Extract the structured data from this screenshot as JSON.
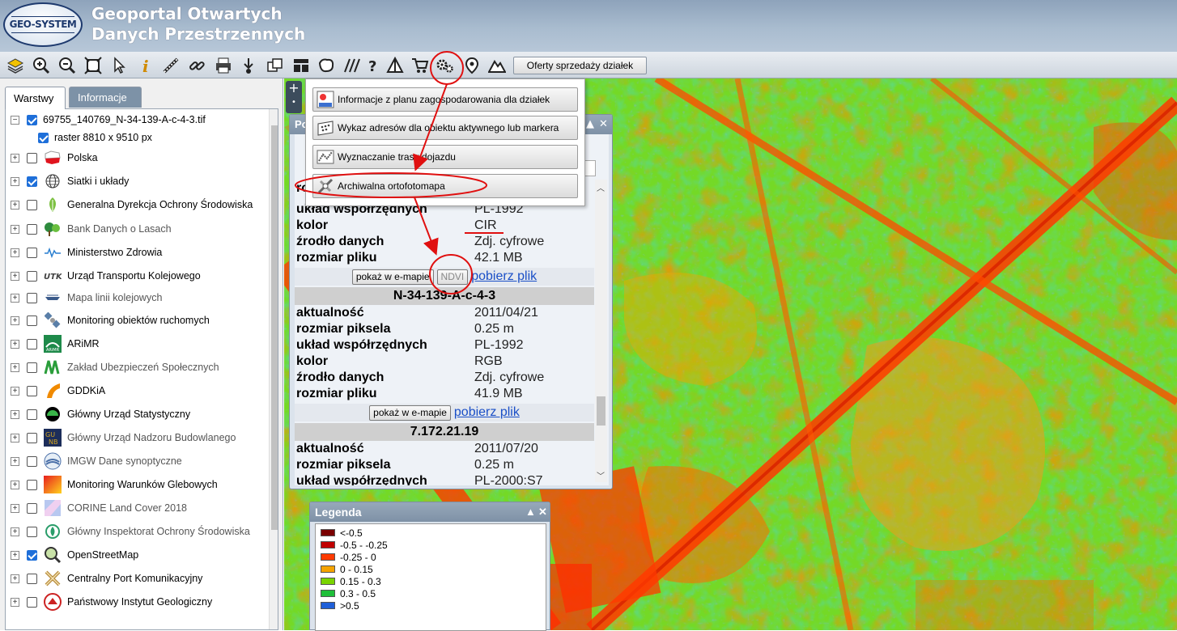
{
  "app": {
    "logo_text": "GEO-SYSTEM",
    "title_line1": "Geoportal Otwartych",
    "title_line2": "Danych Przestrzennych"
  },
  "toolbar": {
    "icons": [
      "layers-icon",
      "zoom-in-icon",
      "zoom-out-icon",
      "zoom-extent-icon",
      "pointer-icon",
      "info-icon",
      "measure-distance-icon",
      "measure-link-icon",
      "print-icon",
      "download-icon",
      "copy-icon",
      "layout-icon",
      "area-icon",
      "hatch-icon",
      "help-icon",
      "triangle-icon",
      "cart-icon",
      "tools-gears-icon",
      "location-pin-icon",
      "terrain-icon"
    ],
    "offers_button": "Oferty sprzedaży działek"
  },
  "left_panel": {
    "tabs": [
      {
        "label": "Warstwy",
        "active": true
      },
      {
        "label": "Informacje",
        "active": false
      }
    ],
    "layers": [
      {
        "label": "69755_140769_N-34-139-A-c-4-3.tif",
        "checked": true,
        "expander": "minus",
        "icon": "none",
        "indent": 0,
        "dim": false
      },
      {
        "label": "raster 8810 x 9510 px",
        "checked": true,
        "expander": "none",
        "icon": "none",
        "indent": 1,
        "dim": false
      },
      {
        "label": "Polska",
        "checked": false,
        "expander": "plus",
        "icon": "poland-flag-icon",
        "indent": 0,
        "dim": false
      },
      {
        "label": "Siatki i układy",
        "checked": true,
        "expander": "plus",
        "icon": "globe-grid-icon",
        "indent": 0,
        "dim": false
      },
      {
        "label": "Generalna Dyrekcja Ochrony Środowiska",
        "checked": false,
        "expander": "plus",
        "icon": "leaf-icon",
        "indent": 0,
        "dim": false
      },
      {
        "label": "Bank Danych o Lasach",
        "checked": false,
        "expander": "plus",
        "icon": "forest-icon",
        "indent": 0,
        "dim": true
      },
      {
        "label": "Ministerstwo Zdrowia",
        "checked": false,
        "expander": "plus",
        "icon": "pulse-icon",
        "indent": 0,
        "dim": false
      },
      {
        "label": "Urząd Transportu Kolejowego",
        "checked": false,
        "expander": "plus",
        "icon": "utk-logo-icon",
        "indent": 0,
        "dim": false
      },
      {
        "label": "Mapa linii kolejowych",
        "checked": false,
        "expander": "plus",
        "icon": "railway-icon",
        "indent": 0,
        "dim": true
      },
      {
        "label": "Monitoring obiektów ruchomych",
        "checked": false,
        "expander": "plus",
        "icon": "satellite-icon",
        "indent": 0,
        "dim": false
      },
      {
        "label": "ARiMR",
        "checked": false,
        "expander": "plus",
        "icon": "arimr-logo-icon",
        "indent": 0,
        "dim": false
      },
      {
        "label": "Zakład Ubezpieczeń Społecznych",
        "checked": false,
        "expander": "plus",
        "icon": "zus-logo-icon",
        "indent": 0,
        "dim": true
      },
      {
        "label": "GDDKiA",
        "checked": false,
        "expander": "plus",
        "icon": "road-icon",
        "indent": 0,
        "dim": false
      },
      {
        "label": "Główny Urząd Statystyczny",
        "checked": false,
        "expander": "plus",
        "icon": "gus-logo-icon",
        "indent": 0,
        "dim": false
      },
      {
        "label": "Główny Urząd Nadzoru Budowlanego",
        "checked": false,
        "expander": "plus",
        "icon": "gunb-logo-icon",
        "indent": 0,
        "dim": true
      },
      {
        "label": "IMGW Dane synoptyczne",
        "checked": false,
        "expander": "plus",
        "icon": "imgw-logo-icon",
        "indent": 0,
        "dim": true
      },
      {
        "label": "Monitoring Warunków Glebowych",
        "checked": false,
        "expander": "plus",
        "icon": "soil-gradient-icon",
        "indent": 0,
        "dim": false
      },
      {
        "label": "CORINE Land Cover 2018",
        "checked": false,
        "expander": "plus",
        "icon": "corine-icon",
        "indent": 0,
        "dim": true
      },
      {
        "label": "Główny Inspektorat Ochrony Środowiska",
        "checked": false,
        "expander": "plus",
        "icon": "gios-logo-icon",
        "indent": 0,
        "dim": true
      },
      {
        "label": "OpenStreetMap",
        "checked": true,
        "expander": "plus",
        "icon": "magnifier-map-icon",
        "indent": 0,
        "dim": false
      },
      {
        "label": "Centralny Port Komunikacyjny",
        "checked": false,
        "expander": "plus",
        "icon": "cpk-logo-icon",
        "indent": 0,
        "dim": false
      },
      {
        "label": "Państwowy Instytut Geologiczny",
        "checked": false,
        "expander": "plus",
        "icon": "pig-logo-icon",
        "indent": 0,
        "dim": false
      }
    ]
  },
  "menu": {
    "items": [
      {
        "label": "Informacje z planu zagospodarowania dla działek",
        "icon": "mpzp-icon"
      },
      {
        "label": "Wykaz adresów dla obiektu aktywnego lub markera",
        "icon": "address-list-icon"
      },
      {
        "label": "Wyznaczanie trasy dojazdu",
        "icon": "route-icon"
      },
      {
        "label": "Archiwalna ortofotomapa",
        "icon": "archive-ortho-icon"
      }
    ]
  },
  "popup": {
    "title_fragment": "Po",
    "partial_top_label": "ro",
    "block1": {
      "rows": [
        {
          "k": "układ współrzędnych",
          "v": "PL-1992"
        },
        {
          "k": "kolor",
          "v": "CIR"
        },
        {
          "k": "źrodło danych",
          "v": "Zdj. cyfrowe"
        },
        {
          "k": "rozmiar pliku",
          "v": "42.1 MB"
        }
      ],
      "show_btn": "pokaż w e-mapie",
      "ndvi_btn": "NDVI",
      "download": "pobierz plik"
    },
    "block2": {
      "header": "N-34-139-A-c-4-3",
      "rows": [
        {
          "k": "aktualność",
          "v": "2011/04/21"
        },
        {
          "k": "rozmiar piksela",
          "v": "0.25 m"
        },
        {
          "k": "układ współrzędnych",
          "v": "PL-1992"
        },
        {
          "k": "kolor",
          "v": "RGB"
        },
        {
          "k": "źrodło danych",
          "v": "Zdj. cyfrowe"
        },
        {
          "k": "rozmiar pliku",
          "v": "41.9 MB"
        }
      ],
      "show_btn": "pokaż w e-mapie",
      "download": "pobierz plik"
    },
    "block3": {
      "header": "7.172.21.19",
      "rows": [
        {
          "k": "aktualność",
          "v": "2011/07/20"
        },
        {
          "k": "rozmiar piksela",
          "v": "0.25 m"
        },
        {
          "k": "układ współrzędnych",
          "v": "PL-2000:S7"
        }
      ]
    },
    "collapse": "▲",
    "close": "✕"
  },
  "legend": {
    "title": "Legenda",
    "collapse": "▲",
    "close": "✕",
    "entries": [
      {
        "label": "<-0.5",
        "color": "#7a0000"
      },
      {
        "label": "-0.5 - -0.25",
        "color": "#c00000"
      },
      {
        "label": "-0.25 - 0",
        "color": "#ff3a00"
      },
      {
        "label": "0 - 0.15",
        "color": "#f5a300"
      },
      {
        "label": "0.15 - 0.3",
        "color": "#7ad400"
      },
      {
        "label": "0.3 - 0.5",
        "color": "#1fbf3a"
      },
      {
        "label": ">0.5",
        "color": "#1f5fd8"
      }
    ]
  },
  "colors": {
    "annotation_red": "#e01010",
    "header_bg": "#9fb3c8",
    "link_blue": "#1a4fc7"
  }
}
